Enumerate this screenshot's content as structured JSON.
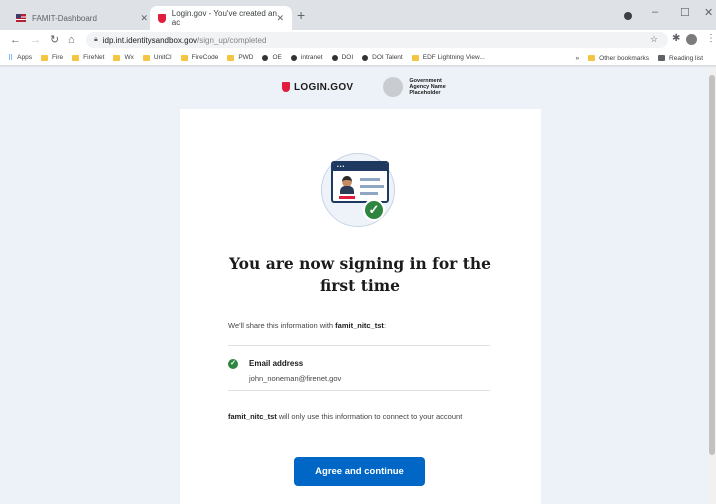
{
  "browser": {
    "tabs": [
      {
        "title": "FAMIT-Dashboard",
        "active": false
      },
      {
        "title": "Login.gov - You've created an ac",
        "active": true
      }
    ],
    "new_tab": "+",
    "window_controls": {
      "minimize": "–",
      "maximize": "☐",
      "close": "✕"
    },
    "address": {
      "host": "idp.int.identitysandbox.gov",
      "path": "/sign_up/completed"
    },
    "bookmarks": [
      "Apps",
      "Fire",
      "FireNet",
      "Wx",
      "UnitCl",
      "FireCode",
      "PWD",
      "OE",
      "intranet",
      "DOI",
      "DOI Talent",
      "EDF Lightning View..."
    ],
    "bookmarks_more": "»",
    "bookmarks_right": [
      "Other bookmarks",
      "Reading list"
    ]
  },
  "header": {
    "logo_text": "LOGIN.GOV",
    "agency_name": "Government Agency Name Placeholder"
  },
  "content": {
    "heading": "You are now signing in for the first time",
    "share_prefix": "We'll share this information with ",
    "service_provider": "famit_nitc_tst",
    "share_suffix": ":",
    "attribute_label": "Email address",
    "attribute_value": "john_noneman@firenet.gov",
    "usage_suffix": " will only use this information to connect to your account",
    "button_label": "Agree and continue"
  },
  "colors": {
    "accent": "#0067c6",
    "success": "#2e8540",
    "brand_red": "#e21c3d",
    "page_bg": "#edf2f9"
  }
}
